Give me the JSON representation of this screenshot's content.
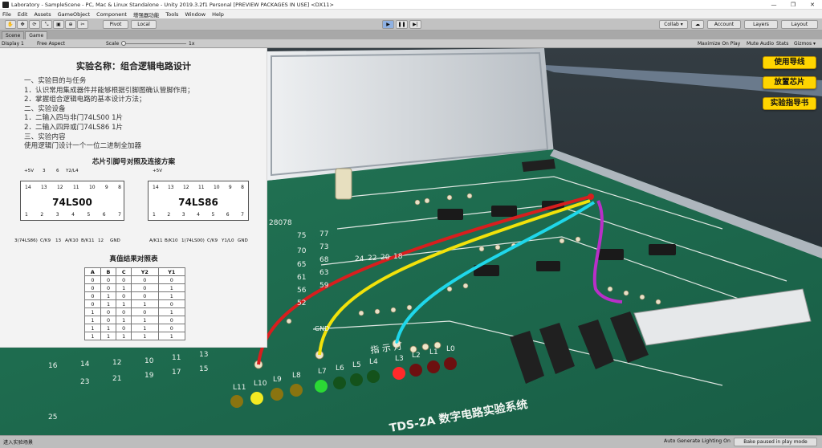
{
  "window": {
    "title": "Laboratory - SampleScene - PC, Mac & Linux Standalone - Unity 2019.3.2f1 Personal [PREVIEW PACKAGES IN USE] <DX11>"
  },
  "menu": [
    "File",
    "Edit",
    "Assets",
    "GameObject",
    "Component",
    "增强器功能",
    "Tools",
    "Window",
    "Help"
  ],
  "toolbar": {
    "pivot": "Pivot",
    "local": "Local",
    "collab": "Collab ▾",
    "account": "Account",
    "layers": "Layers",
    "layout": "Layout"
  },
  "tabs": {
    "scene": "Scene",
    "game": "Game"
  },
  "gamebar": {
    "display": "Display 1",
    "aspect": "Free Aspect",
    "scale_label": "Scale",
    "scale_value": "1x",
    "maximize": "Maximize On Play",
    "mute": "Mute Audio",
    "stats": "Stats",
    "gizmos": "Gizmos ▾"
  },
  "experiment": {
    "title": "实验名称：组合逻辑电路设计",
    "lines": [
      "一、实验目的与任务",
      "1．认识常用集成器件并能够根据引脚图确认管脚作用；",
      "2．掌握组合逻辑电路的基本设计方法；",
      "二、实验设备",
      "1．二输入四与非门74LS00    1片",
      "2．二输入四异或门74LS86    1片",
      "三、实验内容",
      "使用逻辑门设计一个一位二进制全加器"
    ],
    "chip_title": "芯片引脚号对照及连接方案",
    "chip1": {
      "name": "74LS00",
      "top_labels": [
        "+5V",
        "3",
        "6",
        "Y2/L4"
      ],
      "top_pins": [
        "14",
        "13",
        "12",
        "11",
        "10",
        "9",
        "8"
      ],
      "bottom_pins": [
        "1",
        "2",
        "3",
        "4",
        "5",
        "6",
        "7"
      ],
      "bottom_labels": [
        "3(74LS86)",
        "C/K9",
        "13",
        "A/K10",
        "B/K11",
        "12",
        "GND"
      ]
    },
    "chip2": {
      "name": "74LS86",
      "top_labels": [
        "+5V"
      ],
      "top_pins": [
        "14",
        "13",
        "12",
        "11",
        "10",
        "9",
        "8"
      ],
      "bottom_pins": [
        "1",
        "2",
        "3",
        "4",
        "5",
        "6",
        "7"
      ],
      "bottom_labels": [
        "A/K11",
        "B/K10",
        "1(74LS00)",
        "C/K9",
        "Y1/L0",
        "GND"
      ]
    },
    "truth_title": "真值结果对照表",
    "truth_headers": [
      "A",
      "B",
      "C",
      "Y2",
      "Y1"
    ],
    "truth_rows": [
      [
        "0",
        "0",
        "0",
        "0",
        "0"
      ],
      [
        "0",
        "0",
        "1",
        "0",
        "1"
      ],
      [
        "0",
        "1",
        "0",
        "0",
        "1"
      ],
      [
        "0",
        "1",
        "1",
        "1",
        "0"
      ],
      [
        "1",
        "0",
        "0",
        "0",
        "1"
      ],
      [
        "1",
        "0",
        "1",
        "1",
        "0"
      ],
      [
        "1",
        "1",
        "0",
        "1",
        "0"
      ],
      [
        "1",
        "1",
        "1",
        "1",
        "1"
      ]
    ]
  },
  "buttons": {
    "guide": "使用导线",
    "place_chip": "放置芯片",
    "manual": "实验指导书"
  },
  "board": {
    "indicator": "指 示 灯",
    "brand": "TDS-2A 数字电路实验系统",
    "led_labels": [
      "L11",
      "L10",
      "L9",
      "L8",
      "L7",
      "L6",
      "L5",
      "L4",
      "L3",
      "L2",
      "L1",
      "L0"
    ],
    "gnd": "GND",
    "numbers": [
      "28078",
      "75",
      "70",
      "65",
      "61",
      "56",
      "52",
      "59",
      "63",
      "68",
      "73",
      "77",
      "24",
      "22",
      "20",
      "18",
      "16",
      "14",
      "12",
      "10",
      "11",
      "13",
      "15",
      "17",
      "19",
      "21",
      "23",
      "25"
    ]
  },
  "status": {
    "left": "进入实验场景",
    "lighting": "Auto Generate Lighting On",
    "paused": "Bake paused in play mode"
  },
  "colors": {
    "accent": "#ffd500",
    "board": "#1f6b4e",
    "wire_red": "#d81e1e",
    "wire_yellow": "#f2e20a",
    "wire_cyan": "#1fd7ea",
    "wire_purple": "#b92fc8"
  }
}
